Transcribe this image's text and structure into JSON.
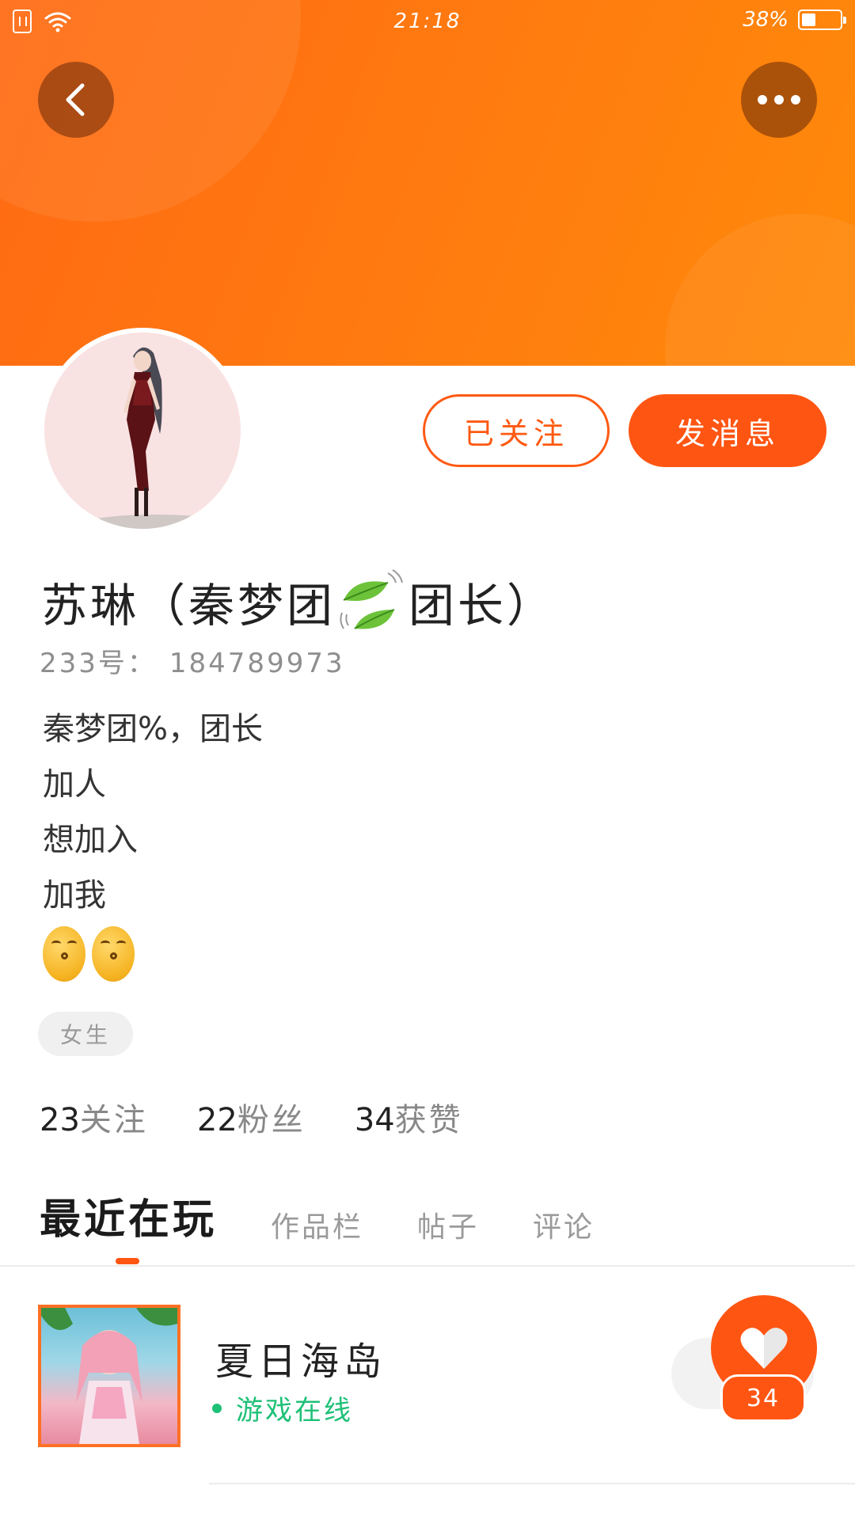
{
  "status_bar": {
    "time": "21:18",
    "battery": "38%",
    "battery_level": 0.38,
    "icons": [
      "sim-icon",
      "wifi-icon",
      "battery-icon"
    ]
  },
  "header": {
    "accent_color": "#ff6a13",
    "back_icon": "chevron-left-icon",
    "more_icon": "more-dots-icon"
  },
  "profile": {
    "name_prefix": "苏琳（秦梦团",
    "name_suffix": "团长）",
    "name_emoji": "leaf-fluttering-emoji",
    "uid_label": "233号：",
    "uid": "184789973",
    "bio": [
      "秦梦团%，团长",
      "加人",
      "想加入",
      "加我"
    ],
    "bio_emoji": [
      "kissing-closed-eyes-emoji",
      "kissing-closed-eyes-emoji"
    ],
    "gender_tag": "女生"
  },
  "actions": {
    "followed_label": "已关注",
    "message_label": "发消息",
    "primary_color": "#ff5512"
  },
  "stats": [
    {
      "value": "23",
      "label": "关注"
    },
    {
      "value": "22",
      "label": "粉丝"
    },
    {
      "value": "34",
      "label": "获赞"
    }
  ],
  "tabs": [
    {
      "label": "最近在玩",
      "active": true
    },
    {
      "label": "作品栏",
      "active": false
    },
    {
      "label": "帖子",
      "active": false
    },
    {
      "label": "评论",
      "active": false
    }
  ],
  "recent_games": [
    {
      "name": "夏日海岛",
      "status": "游戏在线",
      "status_color": "#1fc077"
    }
  ],
  "like_fab": {
    "icon": "heart-icon",
    "count": "34"
  }
}
